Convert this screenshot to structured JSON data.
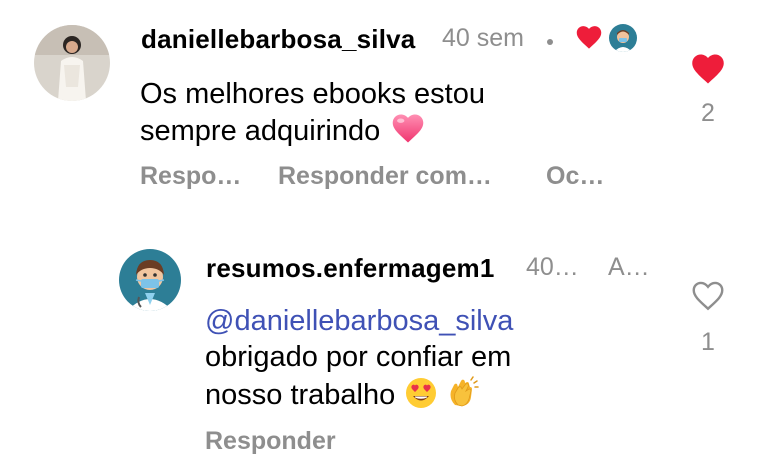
{
  "comment": {
    "username": "daniellebarbosa_silva",
    "time": "40 sem",
    "dot": "•",
    "text_line1": "Os melhores ebooks estou",
    "text_line2": "sempre adquirindo",
    "emoji": "heart-emoji",
    "likes": "2",
    "liked": true,
    "actions": [
      "Respo…",
      "Responder com…",
      "Oc…"
    ]
  },
  "reply": {
    "username": "resumos.enfermagem1",
    "time": "40…",
    "extra": "A…",
    "mention": "@daniellebarbosa_silva",
    "text_line1": "obrigado por confiar em",
    "text_line2": "nosso trabalho",
    "emojis": [
      "heart-eyes-emoji",
      "clapping-hands-emoji"
    ],
    "likes": "1",
    "liked": false,
    "action": "Responder"
  },
  "colors": {
    "like_red": "#ee1d3a",
    "mention_blue": "#3f51b5",
    "muted_gray": "#8e8e8e"
  }
}
